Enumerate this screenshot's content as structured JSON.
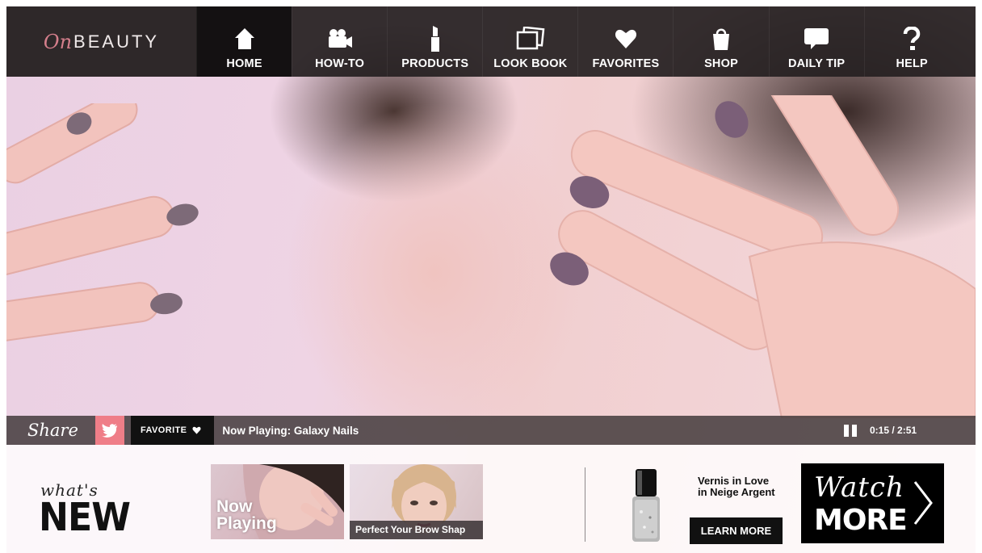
{
  "brand": {
    "prefix": "On",
    "name": "BEAUTY"
  },
  "nav": {
    "items": [
      {
        "label": "HOME",
        "icon": "home-icon",
        "active": true
      },
      {
        "label": "HOW-TO",
        "icon": "video-camera-icon",
        "active": false
      },
      {
        "label": "PRODUCTS",
        "icon": "lipstick-icon",
        "active": false
      },
      {
        "label": "LOOK BOOK",
        "icon": "photos-icon",
        "active": false
      },
      {
        "label": "FAVORITES",
        "icon": "heart-icon",
        "active": false
      },
      {
        "label": "SHOP",
        "icon": "shopping-bag-icon",
        "active": false
      },
      {
        "label": "DAILY TIP",
        "icon": "speech-bubble-icon",
        "active": false
      },
      {
        "label": "HELP",
        "icon": "question-mark-icon",
        "active": false
      }
    ]
  },
  "player": {
    "share_label": "Share",
    "favorite_label": "FAVORITE",
    "now_playing": "Now Playing: Galaxy Nails",
    "time": "0:15 / 2:51"
  },
  "whats_new": {
    "title_small": "what's",
    "title_big": "NEW",
    "thumbnails": [
      {
        "caption": "Now Playing"
      },
      {
        "caption": "Perfect Your Brow Shap"
      }
    ]
  },
  "promo": {
    "product_line1": "Vernis in Love",
    "product_line2": "in Neige Argent",
    "learn_more": "LEARN MORE",
    "watch_line1": "Watch",
    "watch_line2": "MORE"
  },
  "colors": {
    "accent_pink": "#ef7e88",
    "brand_pink": "#d57f8c",
    "nav_bg": "#262021",
    "nav_active": "#141112"
  }
}
